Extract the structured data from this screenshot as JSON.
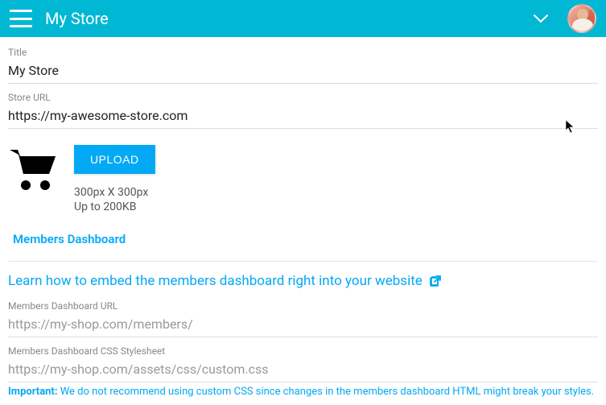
{
  "header": {
    "title": "My Store"
  },
  "fields": {
    "title_label": "Title",
    "title_value": "My Store",
    "url_label": "Store URL",
    "url_value": "https://my-awesome-store.com"
  },
  "logo": {
    "upload_label": "UPLOAD",
    "hint_size": "300px X 300px",
    "hint_limit": "Up to 200KB"
  },
  "members": {
    "section_title": "Members Dashboard",
    "embed_link_text": "Learn how to embed the members dashboard right into your website",
    "url_label": "Members Dashboard URL",
    "url_placeholder": "https://my-shop.com/members/",
    "css_label": "Members Dashboard CSS Stylesheet",
    "css_placeholder": "https://my-shop.com/assets/css/custom.css",
    "note_strong": "Important:",
    "note_text": " We do not recommend using custom CSS since changes in the members dashboard HTML might break your styles."
  },
  "colors": {
    "accent": "#03a9f4",
    "header": "#00b8d4"
  }
}
